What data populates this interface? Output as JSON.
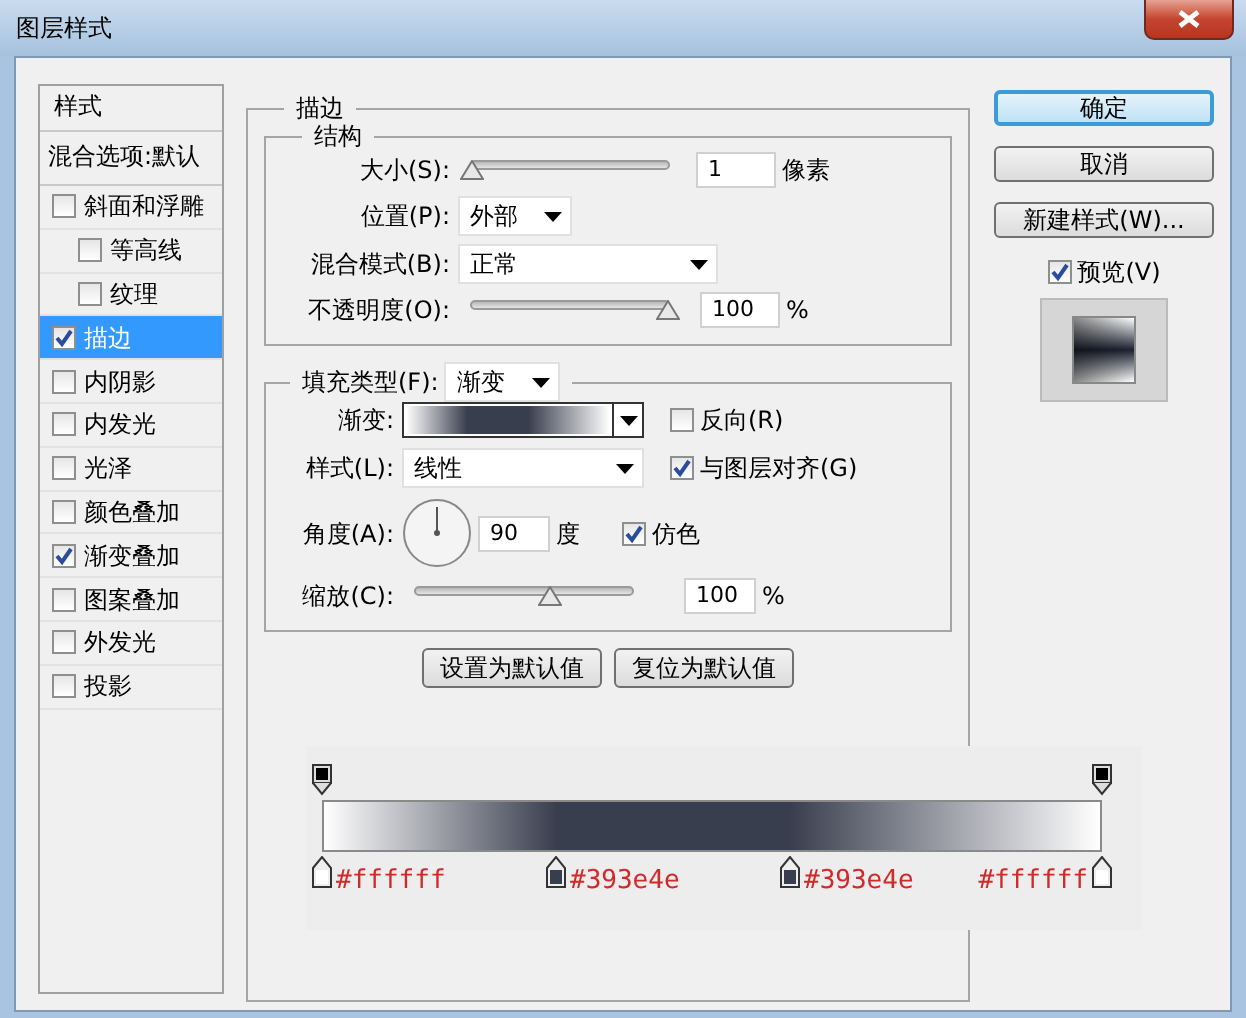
{
  "window": {
    "title": "图层样式"
  },
  "style_list": {
    "header": "样式",
    "blend_options": "混合选项:默认",
    "items": [
      {
        "label": "斜面和浮雕",
        "checked": false,
        "selected": false,
        "children": [
          {
            "label": "等高线",
            "checked": false,
            "selected": false
          },
          {
            "label": "纹理",
            "checked": false,
            "selected": false
          }
        ]
      },
      {
        "label": "描边",
        "checked": true,
        "selected": true
      },
      {
        "label": "内阴影",
        "checked": false,
        "selected": false
      },
      {
        "label": "内发光",
        "checked": false,
        "selected": false
      },
      {
        "label": "光泽",
        "checked": false,
        "selected": false
      },
      {
        "label": "颜色叠加",
        "checked": false,
        "selected": false
      },
      {
        "label": "渐变叠加",
        "checked": true,
        "selected": false
      },
      {
        "label": "图案叠加",
        "checked": false,
        "selected": false
      },
      {
        "label": "外发光",
        "checked": false,
        "selected": false
      },
      {
        "label": "投影",
        "checked": false,
        "selected": false
      }
    ]
  },
  "stroke": {
    "title": "描边",
    "structure": {
      "title": "结构",
      "size": {
        "label": "大小(S):",
        "level": 0,
        "value": "1",
        "unit": "像素"
      },
      "position": {
        "label": "位置(P):",
        "value": "外部"
      },
      "blend_mode": {
        "label": "混合模式(B):",
        "value": "正常"
      },
      "opacity": {
        "label": "不透明度(O):",
        "level": 1,
        "value": "100",
        "unit": "%"
      }
    },
    "fill": {
      "label": "填充类型(F):",
      "value": "渐变",
      "gradient": {
        "label": "渐变:"
      },
      "reverse": {
        "label": "反向(R)",
        "checked": false
      },
      "style": {
        "label": "样式(L):",
        "value": "线性"
      },
      "align": {
        "label": "与图层对齐(G)",
        "checked": true
      },
      "angle": {
        "label": "角度(A):",
        "value": "90",
        "unit": "度"
      },
      "dither": {
        "label": "仿色",
        "checked": true
      },
      "scale": {
        "label": "缩放(C):",
        "level": 0.62,
        "value": "100",
        "unit": "%"
      }
    },
    "buttons": [
      "设置为默认值",
      "复位为默认值"
    ]
  },
  "actions": {
    "buttons": [
      {
        "label": "确定",
        "default": true
      },
      {
        "label": "取消",
        "default": false
      },
      {
        "label": "新建样式(W)...",
        "default": false
      }
    ],
    "preview": {
      "label": "预览(V)",
      "checked": true
    }
  },
  "gradient_editor": {
    "opacity_stops": [
      {
        "level": 0
      },
      {
        "level": 1
      }
    ],
    "color_stops": [
      {
        "level": 0,
        "color": "#ffffff",
        "label": "#ffffff"
      },
      {
        "level": 0.3,
        "color": "#393e4e",
        "label": "#393e4e"
      },
      {
        "level": 0.6,
        "color": "#393e4e",
        "label": "#393e4e"
      },
      {
        "level": 1,
        "color": "#ffffff",
        "label": "#ffffff"
      }
    ]
  }
}
